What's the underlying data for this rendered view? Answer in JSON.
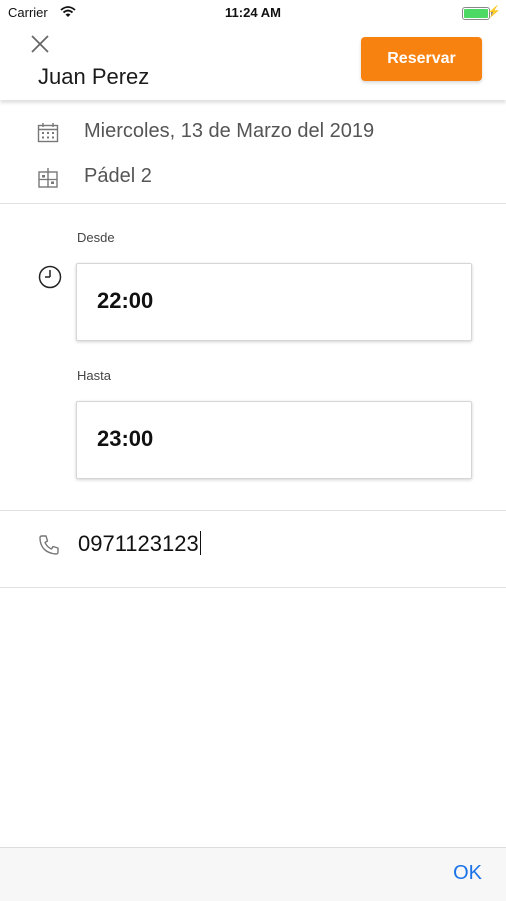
{
  "status_bar": {
    "carrier": "Carrier",
    "time": "11:24 AM",
    "battery_level": 1.0,
    "battery_color": "#4cd964"
  },
  "header": {
    "close_icon": "close-icon",
    "name": "Juan Perez",
    "reserve_label": "Reservar",
    "reserve_color": "#f88210"
  },
  "info": {
    "date_icon": "calendar-icon",
    "date": "Miercoles, 13 de Marzo del 2019",
    "court_icon": "court-icon",
    "court": "Pádel 2"
  },
  "time_range": {
    "icon": "clock-icon",
    "from_label": "Desde",
    "from_value": "22:00",
    "to_label": "Hasta",
    "to_value": "23:00"
  },
  "phone": {
    "icon": "phone-icon",
    "value": "0971123123"
  },
  "footer": {
    "ok_label": "OK",
    "ok_color": "#1a73e8"
  }
}
